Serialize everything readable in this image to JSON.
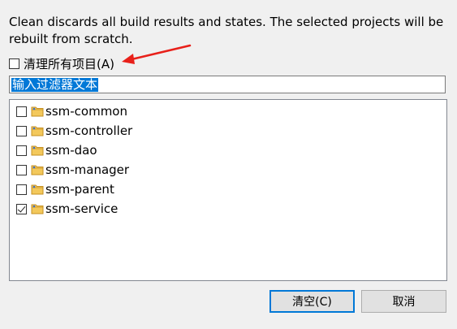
{
  "description": "Clean discards all build results and states. The selected projects will be rebuilt from scratch.",
  "clean_all": {
    "label": "清理所有项目(A)",
    "checked": false
  },
  "filter": {
    "value": "输入过滤器文本"
  },
  "projects": [
    {
      "name": "ssm-common",
      "checked": false
    },
    {
      "name": "ssm-controller",
      "checked": false
    },
    {
      "name": "ssm-dao",
      "checked": false
    },
    {
      "name": "ssm-manager",
      "checked": false
    },
    {
      "name": "ssm-parent",
      "checked": false
    },
    {
      "name": "ssm-service",
      "checked": true
    }
  ],
  "buttons": {
    "clean": "清空(C)",
    "cancel": "取消"
  },
  "annotation": {
    "arrow_color": "#e8201a"
  },
  "colors": {
    "accent": "#0078d7",
    "folder": "#e8b84a"
  }
}
